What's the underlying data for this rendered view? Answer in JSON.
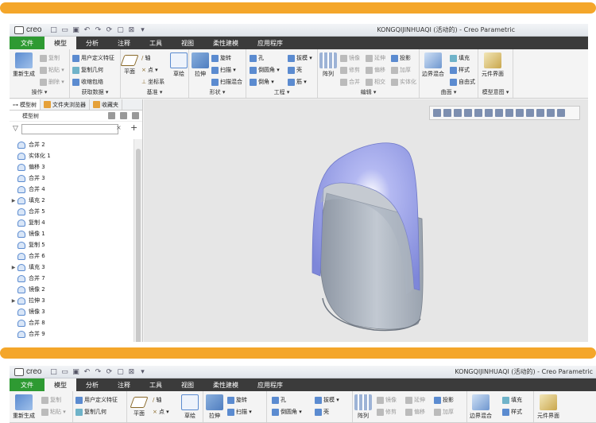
{
  "app": {
    "logo": "creo",
    "title": "KONGQIJINHUAQI (活动的) - Creo Parametric"
  },
  "tabs": [
    {
      "label": "文件"
    },
    {
      "label": "模型"
    },
    {
      "label": "分析"
    },
    {
      "label": "注释"
    },
    {
      "label": "工具"
    },
    {
      "label": "视图"
    },
    {
      "label": "柔性建模"
    },
    {
      "label": "应用程序"
    }
  ],
  "ribbon": {
    "operate": {
      "title": "操作 ▾",
      "regen": "重新生成",
      "copy": "复制",
      "paste": "粘贴 ▾",
      "delete": "删除 ▾"
    },
    "getdata": {
      "title": "获取数据 ▾",
      "udf": "用户定义特征",
      "copygeom": "复制几何",
      "shrink": "收缩包络"
    },
    "datum": {
      "title": "基准 ▾",
      "plane": "平面",
      "axis": "轴",
      "point": "点 ▾",
      "csys": "坐标系",
      "sketch": "草绘"
    },
    "shape": {
      "title": "形状 ▾",
      "extrude": "拉伸",
      "revolve": "旋转",
      "sweep": "扫描 ▾",
      "blend": "扫描混合"
    },
    "eng": {
      "title": "工程 ▾",
      "hole": "孔",
      "round": "倒圆角 ▾",
      "chamfer": "倒角 ▾",
      "draft": "拔模 ▾",
      "shell": "壳",
      "rib": "筋 ▾"
    },
    "edit": {
      "title": "编辑 ▾",
      "pattern": "阵列",
      "mirror": "镜像",
      "extend": "延伸",
      "project": "投影",
      "trim": "修剪",
      "offset": "偏移",
      "thicken": "加厚",
      "merge": "合并",
      "intersect": "相交",
      "solidify": "实体化"
    },
    "surface": {
      "title": "曲面 ▾",
      "boundary": "边界混合",
      "fill": "填充",
      "style": "样式",
      "freeform": "自由式"
    },
    "intent": {
      "title": "模型意图 ▾",
      "element": "元件界面"
    }
  },
  "panel": {
    "tabs": [
      {
        "label": "模型树"
      },
      {
        "label": "文件夹浏览器"
      },
      {
        "label": "收藏夹"
      }
    ],
    "tree_title": "模型树",
    "items": [
      {
        "label": "合并 2",
        "expand": ""
      },
      {
        "label": "实体化 1",
        "expand": ""
      },
      {
        "label": "偏移 3",
        "expand": ""
      },
      {
        "label": "合并 3",
        "expand": ""
      },
      {
        "label": "合并 4",
        "expand": ""
      },
      {
        "label": "填充 2",
        "expand": "▶"
      },
      {
        "label": "合并 5",
        "expand": ""
      },
      {
        "label": "复制 4",
        "expand": ""
      },
      {
        "label": "镜像 1",
        "expand": ""
      },
      {
        "label": "复制 5",
        "expand": ""
      },
      {
        "label": "合并 6",
        "expand": ""
      },
      {
        "label": "填充 3",
        "expand": "▶"
      },
      {
        "label": "合并 7",
        "expand": ""
      },
      {
        "label": "镜像 2",
        "expand": ""
      },
      {
        "label": "拉伸 3",
        "expand": "▶"
      },
      {
        "label": "镜像 3",
        "expand": ""
      },
      {
        "label": "合并 8",
        "expand": ""
      },
      {
        "label": "合并 9",
        "expand": ""
      }
    ]
  },
  "colors": {
    "accent_bar": "#f4a62a",
    "file_tab": "#2e9a32",
    "tab_bar": "#3b3b3b",
    "model_blue": "#8f9be6",
    "model_gray": "#b3bbc6"
  }
}
